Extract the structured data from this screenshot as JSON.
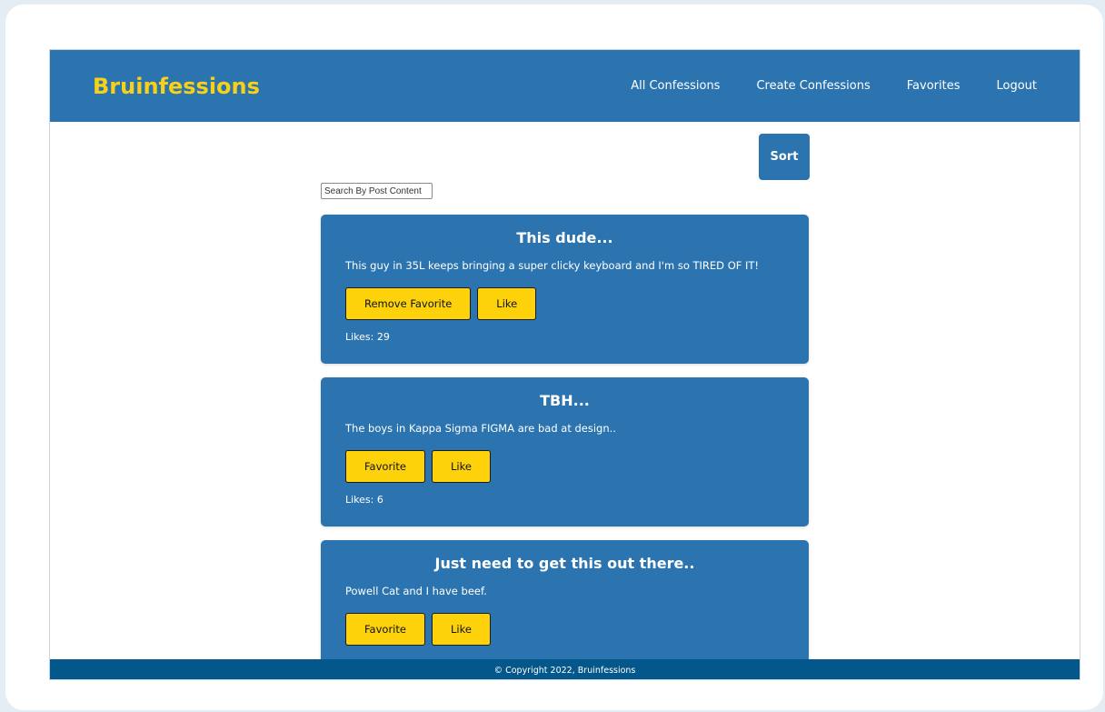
{
  "navbar": {
    "brand": "Bruinfessions",
    "links": [
      "All Confessions",
      "Create Confessions",
      "Favorites",
      "Logout"
    ]
  },
  "toolbar": {
    "sort_label": "Sort",
    "search_placeholder": "Search By Post Content"
  },
  "posts": [
    {
      "title": "This dude...",
      "body": "This guy in 35L keeps bringing a super clicky keyboard and I'm so TIRED OF IT!",
      "favorite_label": "Remove Favorite",
      "like_label": "Like",
      "likes": "Likes: 29"
    },
    {
      "title": "TBH...",
      "body": "The boys in Kappa Sigma FIGMA are bad at design..",
      "favorite_label": "Favorite",
      "like_label": "Like",
      "likes": "Likes: 6"
    },
    {
      "title": "Just need to get this out there..",
      "body": "Powell Cat and I have beef.",
      "favorite_label": "Favorite",
      "like_label": "Like",
      "likes": ""
    }
  ],
  "footer": {
    "text": "© Copyright 2022, Bruinfessions"
  },
  "colors": {
    "primary": "#2b74af",
    "accent": "#fdd20a",
    "brand": "#f7d117",
    "footer": "#04578a"
  }
}
